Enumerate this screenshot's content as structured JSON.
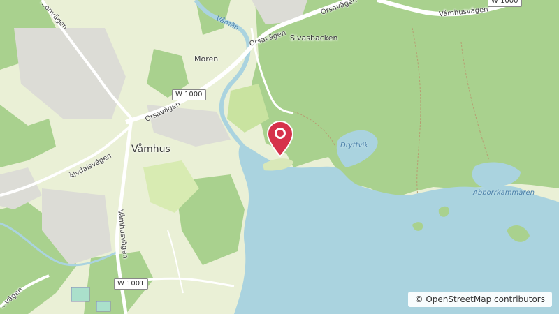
{
  "map": {
    "places": {
      "vamhus": "Våmhus",
      "moren": "Moren",
      "sivasbacken": "Sivasbacken"
    },
    "water": {
      "vaman": "Våmån",
      "dryttvik": "Dryttvik",
      "abborrkammaren": "Abborrkammaren"
    },
    "roads": {
      "orsavagen_1": "Orsavägen",
      "orsavagen_2": "Orsavägen",
      "orsavagen_3": "Orsavägen",
      "vamhusvagen_1": "Våmhusvägen",
      "vamhusvagen_2": "Våmhusvägen",
      "alvdalsvagen": "Älvdalsvägen",
      "bonvagen": "...onvägen",
      "vagen_sw": "...vägen"
    },
    "shields": {
      "w1000": "W 1000",
      "w1000_top": "W 1000",
      "w1001": "W 1001"
    },
    "marker": {
      "color": "#d6324b",
      "icon": "map-pin-icon"
    },
    "attribution": "© OpenStreetMap contributors"
  }
}
